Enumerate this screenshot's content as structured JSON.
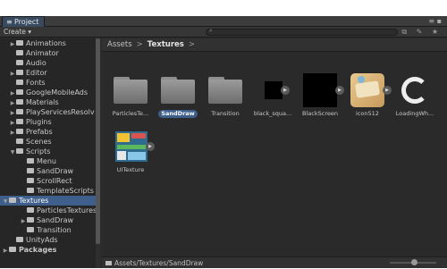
{
  "window": {
    "tab_title": "Project",
    "menu_glyph": "≡ ▪"
  },
  "toolbar": {
    "create_label": "Create ▾",
    "tool_icons": "⧉ ✎ ★"
  },
  "sidebar": {
    "items": [
      {
        "label": "Animations",
        "expandable": true
      },
      {
        "label": "Animator",
        "expandable": false
      },
      {
        "label": "Audio",
        "expandable": false
      },
      {
        "label": "Editor",
        "expandable": true
      },
      {
        "label": "Fonts",
        "expandable": false
      },
      {
        "label": "GoogleMobileAds",
        "expandable": true
      },
      {
        "label": "Materials",
        "expandable": true
      },
      {
        "label": "PlayServicesResolv",
        "expandable": true
      },
      {
        "label": "Plugins",
        "expandable": true
      },
      {
        "label": "Prefabs",
        "expandable": true
      },
      {
        "label": "Scenes",
        "expandable": false
      },
      {
        "label": "Scripts",
        "expandable": true,
        "expanded": true
      },
      {
        "label": "Menu",
        "expandable": false
      },
      {
        "label": "SandDraw",
        "expandable": false
      },
      {
        "label": "ScrollRect",
        "expandable": false
      },
      {
        "label": "TemplateScripts",
        "expandable": false
      },
      {
        "label": "Textures",
        "expandable": true,
        "expanded": true,
        "selected": true
      },
      {
        "label": "ParticlesTextures",
        "expandable": false
      },
      {
        "label": "SandDraw",
        "expandable": true
      },
      {
        "label": "Transition",
        "expandable": false
      },
      {
        "label": "UnityAds",
        "expandable": false
      },
      {
        "label": "Packages",
        "expandable": true
      }
    ]
  },
  "breadcrumb": {
    "root": "Assets",
    "current": "Textures",
    "separator": ">"
  },
  "assets": [
    {
      "label": "ParticlesTe...",
      "kind": "folder"
    },
    {
      "label": "SandDraw",
      "kind": "folder",
      "selected": true
    },
    {
      "label": "Transition",
      "kind": "folder"
    },
    {
      "label": "black_squa...",
      "kind": "texture"
    },
    {
      "label": "BlackScreen",
      "kind": "texture"
    },
    {
      "label": "icon512",
      "kind": "texture"
    },
    {
      "label": "LoadingWh...",
      "kind": "texture"
    },
    {
      "label": "UITexture",
      "kind": "texture"
    }
  ],
  "status": {
    "path": "Assets/Textures/SandDraw"
  },
  "colors": {
    "selection": "#3e5e8c",
    "panel": "#2b2b2b"
  }
}
